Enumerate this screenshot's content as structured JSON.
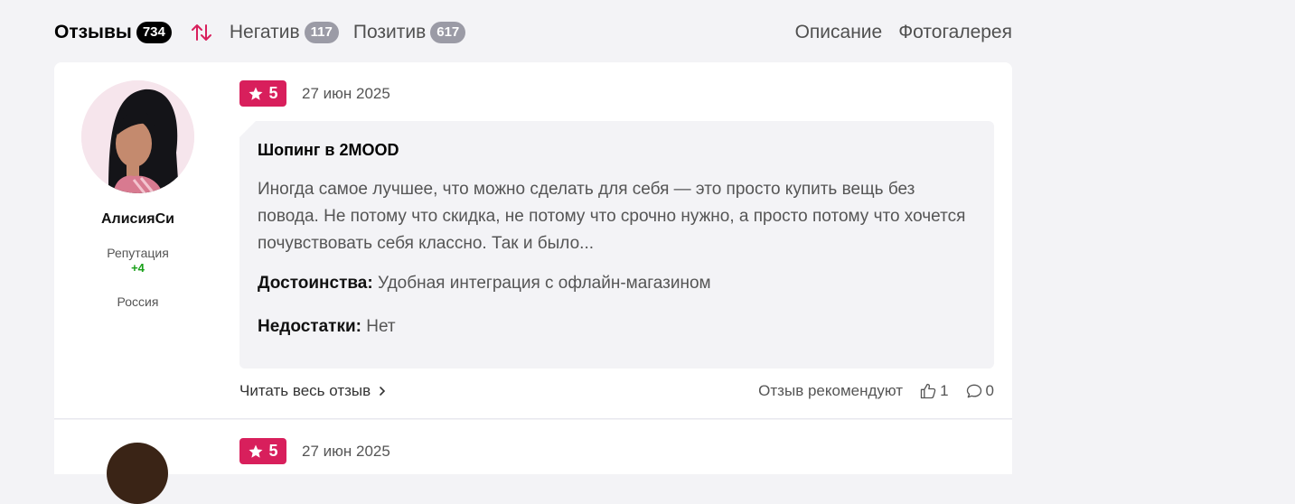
{
  "tabs": {
    "reviews": {
      "label": "Отзывы",
      "count": "734"
    },
    "negative": {
      "label": "Негатив",
      "count": "117"
    },
    "positive": {
      "label": "Позитив",
      "count": "617"
    },
    "description": {
      "label": "Описание"
    },
    "gallery": {
      "label": "Фотогалерея"
    }
  },
  "reviews": [
    {
      "author": "АлисияСи",
      "reputation_label": "Репутация",
      "reputation_value": "+4",
      "country": "Россия",
      "rating": "5",
      "date": "27 июн 2025",
      "title": "Шопинг в 2MOOD",
      "text": "Иногда самое лучшее, что можно сделать для себя — это просто купить вещь без повода. Не потому что скидка, не потому что срочно нужно, а просто потому что хочется почувствовать себя классно. Так и было...",
      "pros_label": "Достоинства:",
      "pros": "Удобная интеграция с офлайн-магазином",
      "cons_label": "Недостатки:",
      "cons": "Нет",
      "read_more": "Читать весь отзыв",
      "recommend_label": "Отзыв рекомендуют",
      "likes": "1",
      "comments": "0"
    },
    {
      "rating": "5",
      "date": "27 июн 2025"
    }
  ],
  "colors": {
    "accent": "#d81f5c",
    "reputation": "#19a019",
    "background": "#f3f3f6"
  },
  "icons": {
    "sort": "sort-arrows-icon",
    "star": "star-icon",
    "like": "thumbs-up-icon",
    "comment": "comment-bubble-icon",
    "chevron": "chevron-right-icon"
  }
}
